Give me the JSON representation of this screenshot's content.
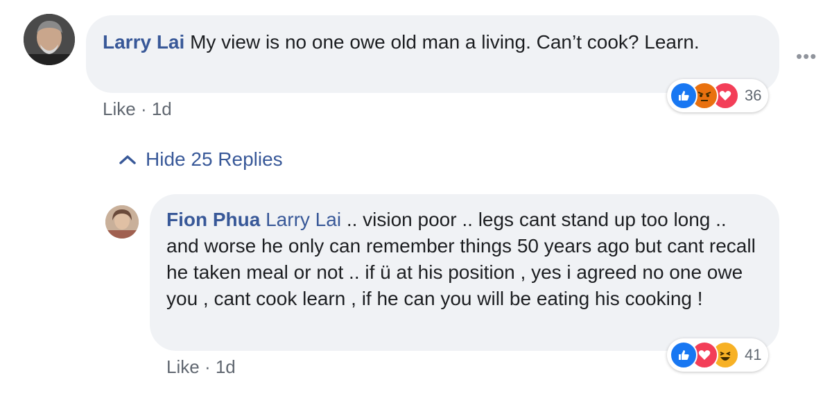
{
  "comment": {
    "author": "Larry Lai",
    "text": "My view is no one owe old man a living. Can’t cook? Learn.",
    "like_label": "Like",
    "separator": "·",
    "time": "1d",
    "reaction_count": "36",
    "reactions": [
      "like-icon",
      "angry-icon",
      "love-icon"
    ]
  },
  "thread": {
    "toggle_label": "Hide 25 Replies"
  },
  "reply": {
    "author": "Fion Phua",
    "mention": "Larry Lai",
    "text": " .. vision poor .. legs cant stand up too long .. and worse he only can remember things 50 years ago but cant recall he taken meal or not .. if ü at his position , yes i agreed no one owe you , cant cook learn , if he can you will be eating his cooking !",
    "like_label": "Like",
    "separator": "·",
    "time": "1d",
    "reaction_count": "41",
    "reactions": [
      "like-icon",
      "love-icon",
      "haha-icon"
    ]
  },
  "colors": {
    "link": "#385898",
    "bubble": "#f0f2f5",
    "like_reaction": "#1877f2",
    "love_reaction": "#f33e58",
    "angry_reaction": "#e9710f",
    "haha_reaction": "#f7b125"
  }
}
